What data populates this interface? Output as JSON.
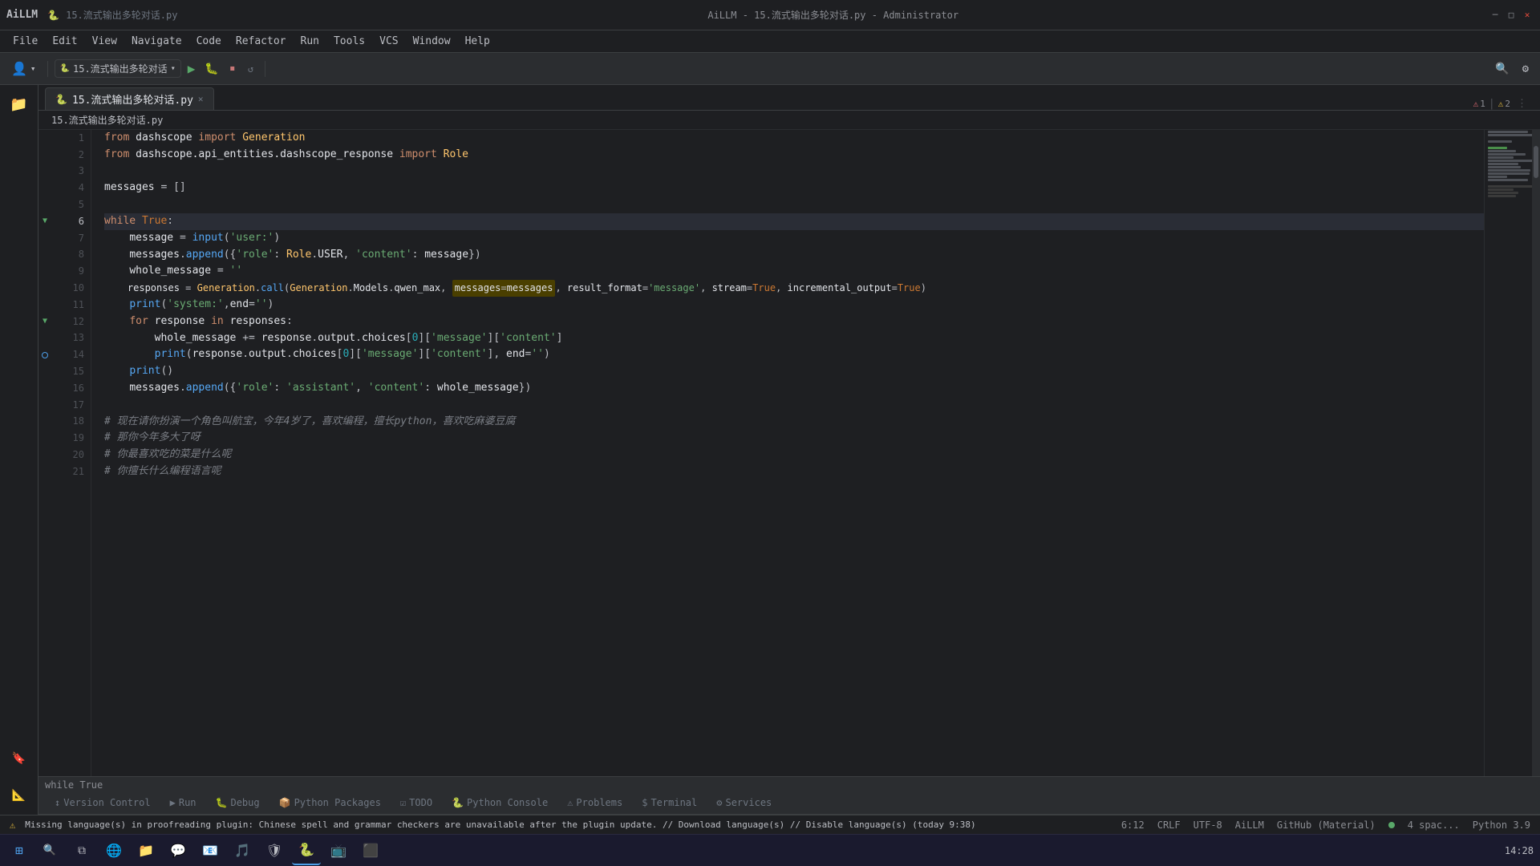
{
  "titleBar": {
    "brand": "AiLLM",
    "fileIcon": "🐍",
    "fileName": "15.流式输出多轮对话.py",
    "centerTitle": "AiLLM - 15.流式输出多轮对话.py - Administrator",
    "minimize": "─",
    "maximize": "□",
    "close": "✕"
  },
  "menuBar": {
    "items": [
      "File",
      "Edit",
      "View",
      "Navigate",
      "Code",
      "Refactor",
      "Run",
      "Tools",
      "VCS",
      "Window",
      "Help"
    ]
  },
  "toolbar": {
    "profileLabel": "👤",
    "runConfig": "15.流式输出多轮对话",
    "runBtn": "▶",
    "debugBtn": "🐛",
    "stopBtn": "⏹",
    "searchBtn": "🔍",
    "settingsBtn": "⚙"
  },
  "breadcrumb": {
    "project": "15.流式输出多轮对话.py"
  },
  "tabs": [
    {
      "label": "15.流式输出多轮对话.py",
      "active": true,
      "icon": "🐍"
    }
  ],
  "errorBadges": {
    "errors": "1",
    "warnings": "2"
  },
  "codeLines": [
    {
      "num": 1,
      "content": "from dashscope import Generation",
      "type": "code"
    },
    {
      "num": 2,
      "content": "from dashscope.api_entities.dashscope_response import Role",
      "type": "code"
    },
    {
      "num": 3,
      "content": "",
      "type": "empty"
    },
    {
      "num": 4,
      "content": "messages = []",
      "type": "code"
    },
    {
      "num": 5,
      "content": "",
      "type": "empty"
    },
    {
      "num": 6,
      "content": "while True:",
      "type": "code",
      "active": true
    },
    {
      "num": 7,
      "content": "    message = input('user:')",
      "type": "code"
    },
    {
      "num": 8,
      "content": "    messages.append({'role': Role.USER, 'content': message})",
      "type": "code"
    },
    {
      "num": 9,
      "content": "    whole_message = ''",
      "type": "code"
    },
    {
      "num": 10,
      "content": "    responses = Generation.call(Generation.Models.qwen_max, messages=messages, result_format='message', stream=True, incremental_output=True)",
      "type": "code"
    },
    {
      "num": 11,
      "content": "    print('system:',end='')",
      "type": "code"
    },
    {
      "num": 12,
      "content": "    for response in responses:",
      "type": "code"
    },
    {
      "num": 13,
      "content": "        whole_message += response.output.choices[0]['message']['content']",
      "type": "code"
    },
    {
      "num": 14,
      "content": "        print(response.output.choices[0]['message']['content'], end='')",
      "type": "code"
    },
    {
      "num": 15,
      "content": "    print()",
      "type": "code"
    },
    {
      "num": 16,
      "content": "    messages.append({'role': 'assistant', 'content': whole_message})",
      "type": "code"
    },
    {
      "num": 17,
      "content": "",
      "type": "empty"
    },
    {
      "num": 18,
      "content": "# 现在请你扮演一个角色叫航宝，今年4岁了，喜欢编程，擅长python，喜欢吃麻婆豆腐",
      "type": "comment"
    },
    {
      "num": 19,
      "content": "# 那你今年多大了呀",
      "type": "comment"
    },
    {
      "num": 20,
      "content": "# 你最喜欢吃的菜是什么呢",
      "type": "comment"
    },
    {
      "num": 21,
      "content": "# 你擅长什么编程语言呢",
      "type": "comment"
    }
  ],
  "bottomPanel": {
    "whileTrue": "while True",
    "tabs": [
      {
        "label": "Version Control",
        "icon": "↕",
        "active": false
      },
      {
        "label": "Run",
        "icon": "▶",
        "active": false
      },
      {
        "label": "Debug",
        "icon": "🐛",
        "active": false
      },
      {
        "label": "Python Packages",
        "icon": "📦",
        "active": false
      },
      {
        "label": "TODO",
        "icon": "☑",
        "active": false
      },
      {
        "label": "Python Console",
        "icon": "🐍",
        "active": false
      },
      {
        "label": "Problems",
        "icon": "⚠",
        "active": false
      },
      {
        "label": "Terminal",
        "icon": "$",
        "active": false
      },
      {
        "label": "Services",
        "icon": "⚙",
        "active": false
      }
    ]
  },
  "statusBar": {
    "warningText": "Missing language(s) in proofreading plugin: Chinese spell and grammar checkers are unavailable after the plugin update. // Download language(s) // Disable language(s) (today 9:38)",
    "lineCol": "6:12",
    "encoding": "CRLF",
    "charset": "UTF-8",
    "profile": "AiLLM",
    "vcs": "GitHub (Material)",
    "indent": "4 spac...",
    "lang": "Python 3.9",
    "time": "14:28"
  },
  "taskbar": {
    "items": [
      {
        "icon": "⊞",
        "name": "windows-start"
      },
      {
        "icon": "🔍",
        "name": "search"
      },
      {
        "icon": "🗂",
        "name": "task-view"
      },
      {
        "icon": "🌐",
        "name": "edge"
      },
      {
        "icon": "📁",
        "name": "explorer"
      },
      {
        "icon": "💬",
        "name": "chat"
      },
      {
        "icon": "📧",
        "name": "mail"
      },
      {
        "icon": "🎵",
        "name": "music"
      },
      {
        "icon": "🛡",
        "name": "security"
      },
      {
        "icon": "🐍",
        "name": "pycharm"
      },
      {
        "icon": "📺",
        "name": "media"
      }
    ],
    "time": "14:28"
  },
  "sidebarItems": [
    {
      "icon": "📁",
      "name": "project",
      "label": "Project"
    },
    {
      "icon": "🔖",
      "name": "bookmarks"
    },
    {
      "icon": "📐",
      "name": "structure"
    }
  ]
}
